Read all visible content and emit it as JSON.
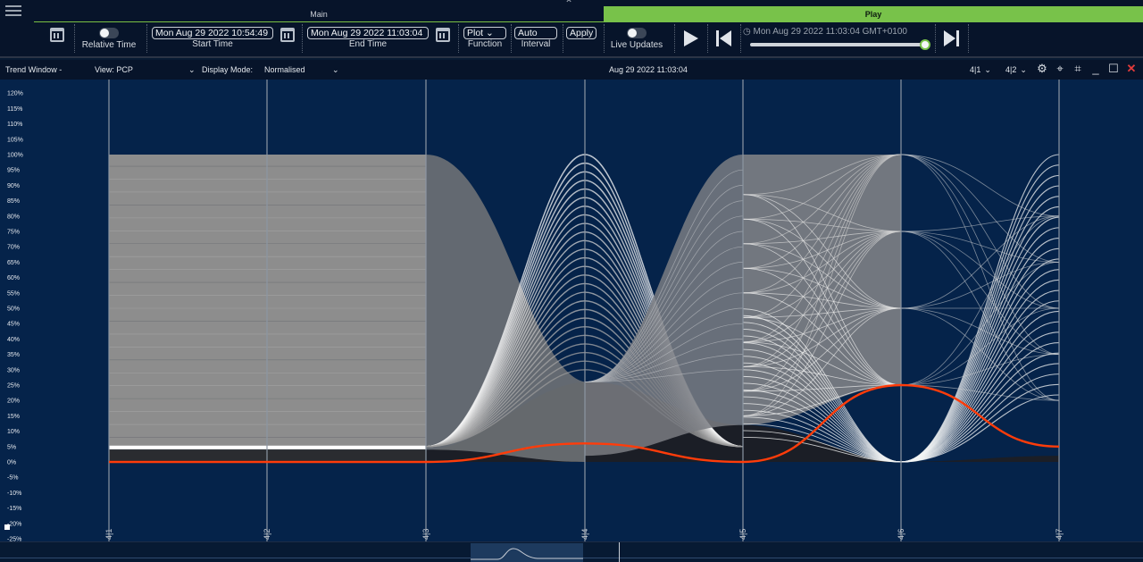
{
  "tabs": {
    "main": "Main",
    "play": "Play"
  },
  "toolbar": {
    "relative_time": "Relative Time",
    "start_time_value": "Mon Aug 29 2022  10:54:49",
    "start_time_label": "Start Time",
    "end_time_value": "Mon Aug 29 2022  11:03:04",
    "end_time_label": "End Time",
    "function_value": "Plot",
    "function_label": "Function",
    "interval_value": "Auto",
    "interval_label": "Interval",
    "apply": "Apply",
    "live_updates": "Live Updates",
    "playback_time": "Mon Aug 29 2022 11:03:04 GMT+0100",
    "playback_progress": 1.0
  },
  "window": {
    "title": "Trend Window -",
    "view_label": "View:",
    "view_value": "PCP",
    "display_mode_label": "Display Mode:",
    "display_mode_value": "Normalised",
    "timestamp": "Aug 29 2022 11:03:04",
    "selector_1": "4|1",
    "selector_2": "4|2"
  },
  "colors": {
    "accent_green": "#78c24a",
    "highlight_line": "#ff3c0a",
    "plot_bg": "#05234a",
    "close_red": "#e23b3b"
  },
  "chart_data": {
    "type": "parallel-coordinates",
    "axes": [
      "4|1",
      "4|2",
      "4|3",
      "4|4",
      "4|5",
      "4|6",
      "4|7"
    ],
    "y_ticks": [
      "120%",
      "115%",
      "110%",
      "105%",
      "100%",
      "95%",
      "90%",
      "85%",
      "80%",
      "75%",
      "70%",
      "65%",
      "60%",
      "55%",
      "50%",
      "45%",
      "40%",
      "35%",
      "30%",
      "25%",
      "20%",
      "15%",
      "10%",
      "5%",
      "0%",
      "-5%",
      "-10%",
      "-15%",
      "-20%",
      "-25%"
    ],
    "ylim": [
      -25,
      120
    ],
    "highlighted_series_percent": [
      0,
      0,
      0,
      6,
      0,
      25,
      5
    ],
    "band_top_percent": [
      100,
      100,
      100,
      100,
      100,
      100,
      100
    ],
    "band_bottom_percent": [
      4,
      4,
      4,
      0,
      0,
      0,
      0
    ]
  }
}
